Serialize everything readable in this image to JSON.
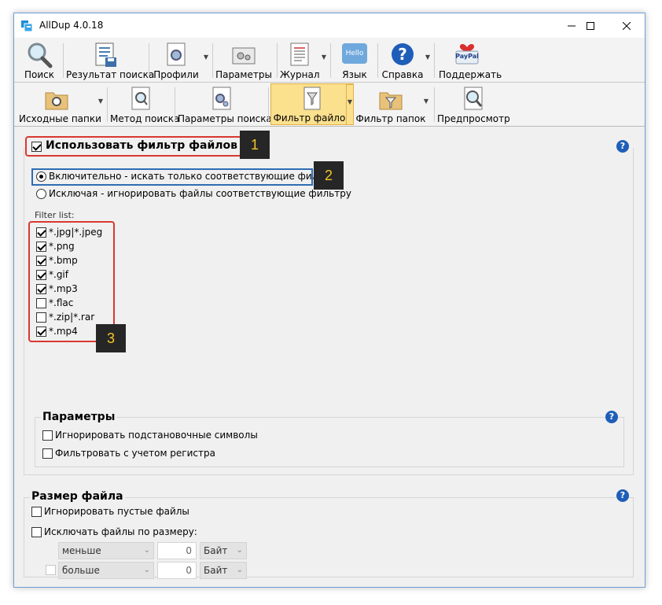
{
  "window": {
    "title": "AllDup 4.0.18"
  },
  "toolbar_main": {
    "search": "Поиск",
    "results": "Результат поиска",
    "profiles": "Профили",
    "settings": "Параметры",
    "log": "Журнал",
    "language": "Язык",
    "language_icon_text": "Hello",
    "help": "Справка",
    "support": "Поддержать",
    "support_icon_text": "PayPal"
  },
  "toolbar_sub": {
    "source_folders": "Исходные папки",
    "search_method": "Метод поиска",
    "search_params": "Параметры поиска",
    "file_filter": "Фильтр файлов",
    "folder_filter": "Фильтр папок",
    "preview": "Предпросмотр"
  },
  "file_filter": {
    "use_filter_label": "Использовать фильтр файлов",
    "use_filter_checked": true,
    "inclusive_label": "Включительно - искать только соответствующие фильтру",
    "exclusive_label": "Исключая - игнорировать файлы соответствующие фильтру",
    "selected_mode": "inclusive",
    "filter_list_label": "Filter list:",
    "items": [
      {
        "pattern": "*.jpg|*.jpeg",
        "checked": true
      },
      {
        "pattern": "*.png",
        "checked": true
      },
      {
        "pattern": "*.bmp",
        "checked": true
      },
      {
        "pattern": "*.gif",
        "checked": true
      },
      {
        "pattern": "*.mp3",
        "checked": true
      },
      {
        "pattern": "*.flac",
        "checked": false
      },
      {
        "pattern": "*.zip|*.rar",
        "checked": false
      },
      {
        "pattern": "*.mp4",
        "checked": true
      }
    ]
  },
  "params": {
    "title": "Параметры",
    "ignore_wildcards": "Игнорировать подстановочные символы",
    "case_sensitive": "Фильтровать с учетом регистра"
  },
  "file_size": {
    "title": "Размер файла",
    "ignore_empty": "Игнорировать пустые файлы",
    "exclude_by_size": "Исключать файлы по размеру:",
    "row1": {
      "op": "меньше",
      "value": "0",
      "unit": "Байт"
    },
    "row2": {
      "op": "больше",
      "value": "0",
      "unit": "Байт"
    }
  },
  "annotations": [
    "1",
    "2",
    "3"
  ],
  "colors": {
    "highlight_red": "#d9382f",
    "highlight_blue": "#2e6db3",
    "badge_bg": "#262626",
    "badge_text": "#f3c629",
    "active_tab": "#fbe08e"
  }
}
